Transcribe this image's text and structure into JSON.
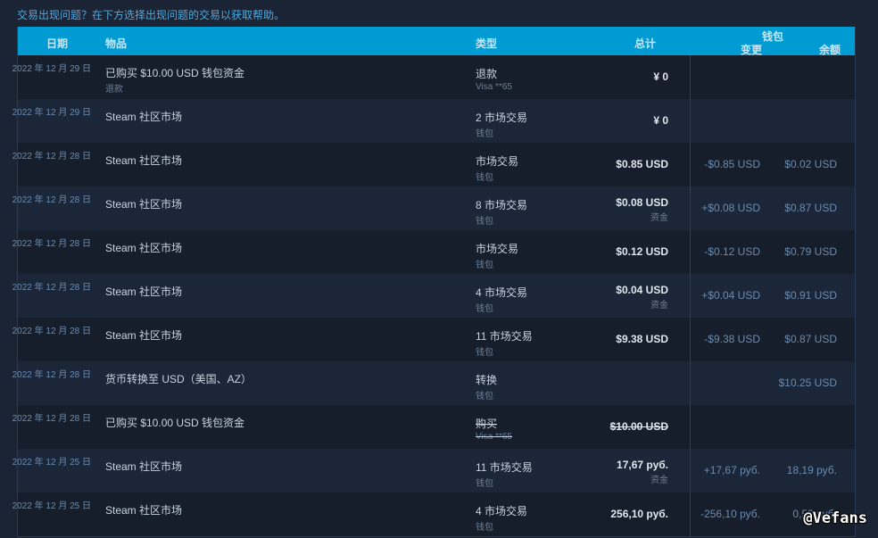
{
  "help_text": "交易出现问题？在下方选择出现问题的交易以获取帮助。",
  "header": {
    "date": "日期",
    "item": "物品",
    "type": "类型",
    "total": "总计",
    "wallet": "钱包",
    "change": "变更",
    "balance": "余额"
  },
  "rows": [
    {
      "date": "2022 年 12 月 29 日",
      "item": "已购买 $10.00 USD 钱包资金",
      "item_sub": "退款",
      "type": "退款",
      "type_sub": "Visa **65",
      "total": "¥ 0",
      "total_sub": "",
      "change": "",
      "balance": ""
    },
    {
      "date": "2022 年 12 月 29 日",
      "item": "Steam 社区市场",
      "item_sub": "",
      "type": "2 市场交易",
      "type_sub": "钱包",
      "total": "¥ 0",
      "total_sub": "",
      "change": "",
      "balance": ""
    },
    {
      "date": "2022 年 12 月 28 日",
      "item": "Steam 社区市场",
      "item_sub": "",
      "type": "市场交易",
      "type_sub": "钱包",
      "total": "$0.85 USD",
      "total_sub": "",
      "change": "-$0.85 USD",
      "balance": "$0.02 USD"
    },
    {
      "date": "2022 年 12 月 28 日",
      "item": "Steam 社区市场",
      "item_sub": "",
      "type": "8 市场交易",
      "type_sub": "钱包",
      "total": "$0.08 USD",
      "total_sub": "资金",
      "change": "+$0.08 USD",
      "balance": "$0.87 USD"
    },
    {
      "date": "2022 年 12 月 28 日",
      "item": "Steam 社区市场",
      "item_sub": "",
      "type": "市场交易",
      "type_sub": "钱包",
      "total": "$0.12 USD",
      "total_sub": "",
      "change": "-$0.12 USD",
      "balance": "$0.79 USD"
    },
    {
      "date": "2022 年 12 月 28 日",
      "item": "Steam 社区市场",
      "item_sub": "",
      "type": "4 市场交易",
      "type_sub": "钱包",
      "total": "$0.04 USD",
      "total_sub": "资金",
      "change": "+$0.04 USD",
      "balance": "$0.91 USD"
    },
    {
      "date": "2022 年 12 月 28 日",
      "item": "Steam 社区市场",
      "item_sub": "",
      "type": "11 市场交易",
      "type_sub": "钱包",
      "total": "$9.38 USD",
      "total_sub": "",
      "change": "-$9.38 USD",
      "balance": "$0.87 USD"
    },
    {
      "date": "2022 年 12 月 28 日",
      "item": "货币转换至 USD（美国、AZ）",
      "item_sub": "",
      "type": "转换",
      "type_sub": "钱包",
      "total": "",
      "total_sub": "",
      "change": "",
      "balance": "$10.25 USD"
    },
    {
      "date": "2022 年 12 月 28 日",
      "item": "已购买 $10.00 USD 钱包资金",
      "item_sub": "",
      "type": "购买",
      "type_sub": "Visa **65",
      "total": "$10.00 USD",
      "total_sub": "",
      "change": "",
      "balance": "",
      "struck": true
    },
    {
      "date": "2022 年 12 月 25 日",
      "item": "Steam 社区市场",
      "item_sub": "",
      "type": "11 市场交易",
      "type_sub": "钱包",
      "total": "17,67 руб.",
      "total_sub": "资金",
      "change": "+17,67 руб.",
      "balance": "18,19 руб."
    },
    {
      "date": "2022 年 12 月 25 日",
      "item": "Steam 社区市场",
      "item_sub": "",
      "type": "4 市场交易",
      "type_sub": "钱包",
      "total": "256,10 руб.",
      "total_sub": "",
      "change": "-256,10 руб.",
      "balance": "0,52 руб."
    }
  ],
  "watermark": "@Vefans"
}
